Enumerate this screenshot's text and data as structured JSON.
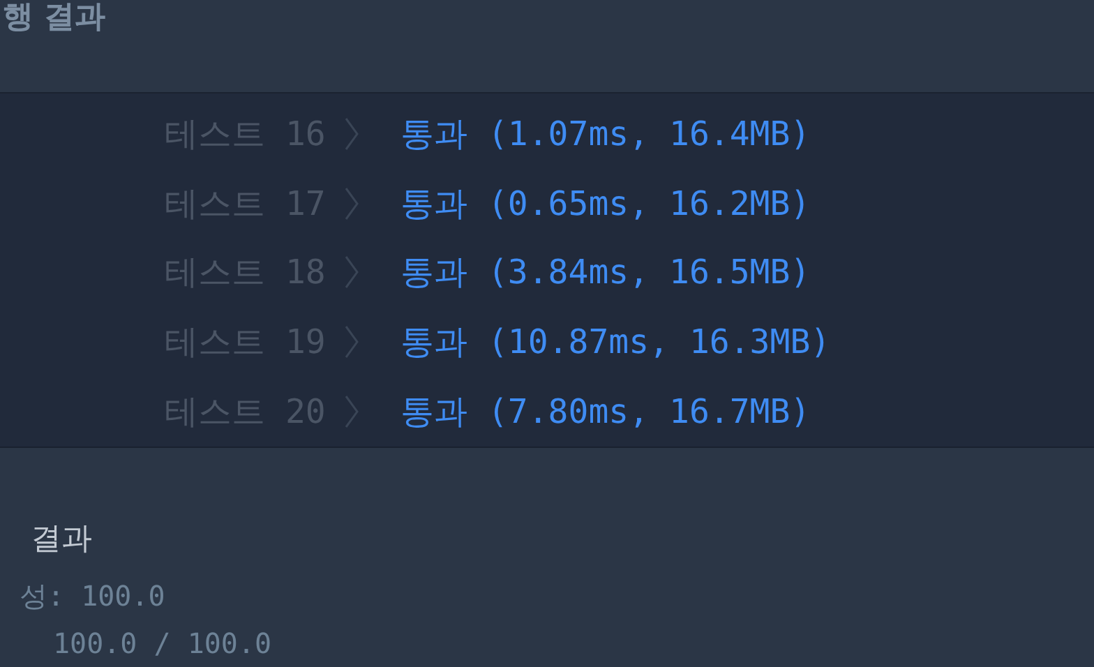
{
  "run_result": {
    "title": "행 결과"
  },
  "tests": [
    {
      "label": "테스트 16",
      "result": "통과 (1.07ms, 16.4MB)"
    },
    {
      "label": "테스트 17",
      "result": "통과 (0.65ms, 16.2MB)"
    },
    {
      "label": "테스트 18",
      "result": "통과 (3.84ms, 16.5MB)"
    },
    {
      "label": "테스트 19",
      "result": "통과 (10.87ms, 16.3MB)"
    },
    {
      "label": "테스트 20",
      "result": "통과 (7.80ms, 16.7MB)"
    }
  ],
  "grading": {
    "title": "결과",
    "lines": [
      "성: 100.0",
      "100.0 / 100.0"
    ]
  }
}
